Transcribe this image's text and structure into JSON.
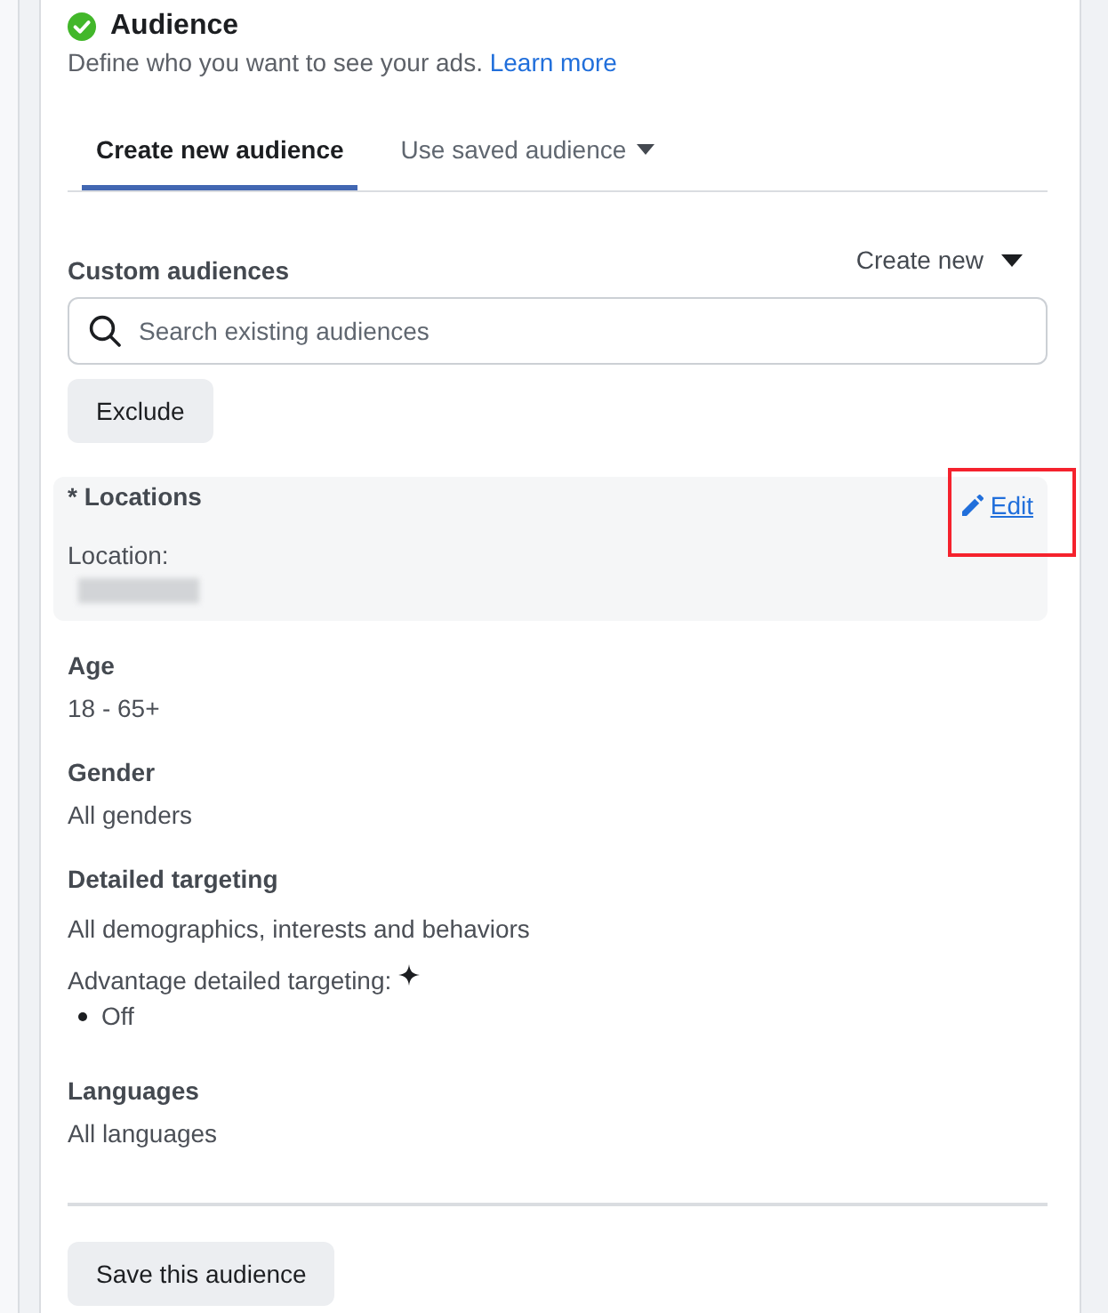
{
  "section": {
    "title": "Audience",
    "complete": true,
    "description": "Define who you want to see your ads.",
    "link": "Learn more"
  },
  "tabs": [
    {
      "label": "Create new audience",
      "selected": true,
      "dropdown": false
    },
    {
      "label": "Use saved audience",
      "selected": false,
      "dropdown": true
    }
  ],
  "custom_audiences": {
    "label": "Custom audiences",
    "create_new": "Create new",
    "search": {
      "placeholder": "Search existing audiences"
    },
    "exclude_button": "Exclude"
  },
  "locations": {
    "label": "* Locations",
    "sublabel": "Location:",
    "edit": "Edit",
    "highlighted": true
  },
  "fields": [
    {
      "label": "Age",
      "value": "18 - 65+"
    },
    {
      "label": "Gender",
      "value": "All genders"
    },
    {
      "label": "Detailed targeting",
      "value": "All demographics, interests and behaviors",
      "advantage": {
        "label": "Advantage detailed targeting:",
        "items": [
          "Off"
        ]
      }
    },
    {
      "label": "Languages",
      "value": "All languages"
    }
  ],
  "save_button": "Save this audience"
}
